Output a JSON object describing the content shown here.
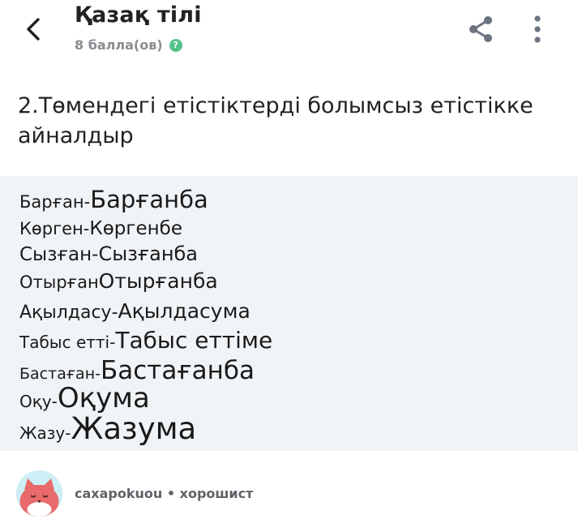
{
  "header": {
    "subject": "Қазақ тілі",
    "points": "8 балла(ов)",
    "help_glyph": "?"
  },
  "question": {
    "text": "2.Төмендегі етістіктерді болымсыз етістікке айналдыр"
  },
  "answer_image": {
    "lines": [
      {
        "left": "Барған-",
        "right": "Барғанба"
      },
      {
        "left": "Көрген-",
        "right": "Көргенбе"
      },
      {
        "left": "Сызған-",
        "right": "Сызғанба"
      },
      {
        "left": "Отырған",
        "right": "Отырғанба"
      },
      {
        "left": "Ақылдасу-",
        "right": "Ақылдасума"
      },
      {
        "left": "Табыс етті-",
        "right": "Табыс еттіме"
      },
      {
        "left": "Бастаған-",
        "right": "Бастағанба"
      },
      {
        "left": "Оқу-",
        "right": "Оқума"
      },
      {
        "left": "Жазу-",
        "right": "Жазума"
      }
    ]
  },
  "author": {
    "name": "caxapokuou",
    "separator": "•",
    "rank": "хорошист"
  },
  "colors": {
    "answer_background": "#f1f4f7",
    "help_badge": "#55c28a",
    "secondary_text": "#8a8d91"
  },
  "icons": [
    "back-arrow-icon",
    "help-icon",
    "share-icon",
    "more-vertical-icon",
    "avatar-cat-icon"
  ]
}
